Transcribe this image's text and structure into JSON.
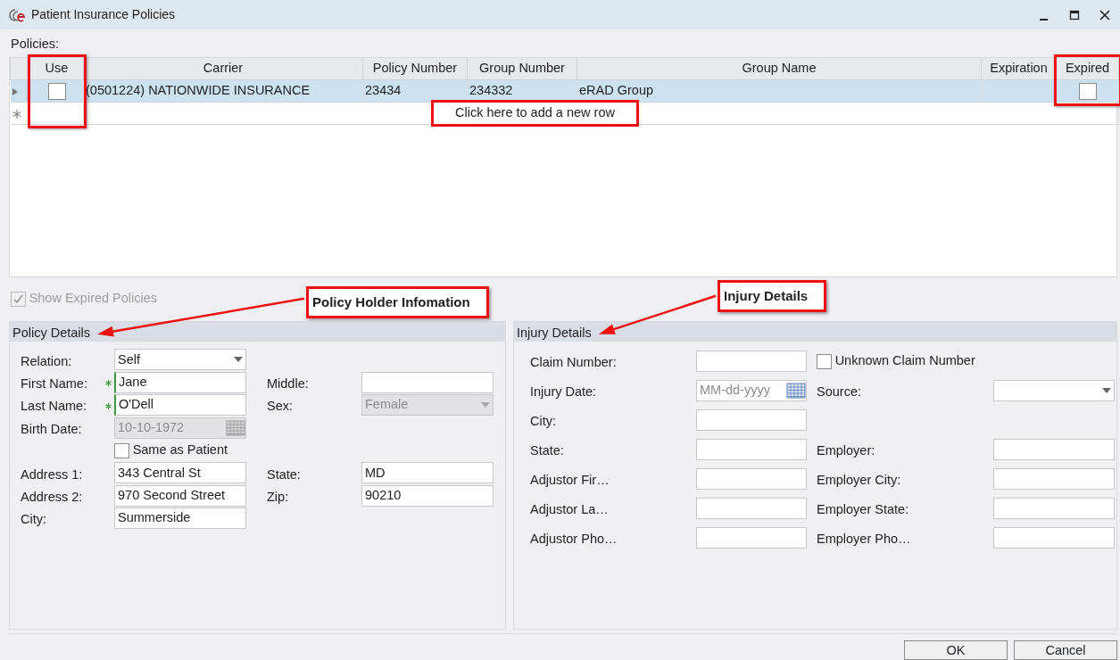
{
  "window": {
    "title": "Patient Insurance Policies"
  },
  "policies_label": "Policies:",
  "table": {
    "columns": [
      {
        "label": "Use",
        "kind": "checkbox",
        "highlighted": true
      },
      {
        "label": "Carrier",
        "kind": "text",
        "highlighted": false
      },
      {
        "label": "Policy Number",
        "kind": "text",
        "highlighted": false
      },
      {
        "label": "Group Number",
        "kind": "text",
        "highlighted": false
      },
      {
        "label": "Group Name",
        "kind": "text",
        "highlighted": false
      },
      {
        "label": "Expiration",
        "kind": "text",
        "highlighted": false
      },
      {
        "label": "Expired",
        "kind": "checkbox",
        "highlighted": true
      }
    ],
    "rows": [
      {
        "selected": true,
        "cells": [
          {
            "checked": false
          },
          {
            "text": "(0501224) NATIONWIDE INSURANCE"
          },
          {
            "text": "23434"
          },
          {
            "text": "234332"
          },
          {
            "text": "eRAD Group"
          },
          {},
          {
            "checked": false
          }
        ]
      }
    ],
    "new_row_hint": {
      "text": "Click here to add a new row",
      "highlighted": true
    }
  },
  "show_expired": {
    "label": "Show Expired Policies",
    "checked": true,
    "disabled": true
  },
  "panels": [
    {
      "title": "Policy Details",
      "callout": "Policy Holder Infomation",
      "rows": [
        {
          "left": {
            "kind": "select",
            "label": "Relation:",
            "value": "Self",
            "required": false,
            "disabled": false
          }
        },
        {
          "left": {
            "kind": "text",
            "label": "First Name:",
            "value": "Jane",
            "required": true,
            "disabled": false
          },
          "right": {
            "kind": "text",
            "label": "Middle:",
            "required": false,
            "disabled": false
          }
        },
        {
          "left": {
            "kind": "text",
            "label": "Last Name:",
            "value": "O'Dell",
            "required": true,
            "disabled": false
          },
          "right": {
            "kind": "select",
            "label": "Sex:",
            "value": "Female",
            "required": false,
            "disabled": true
          }
        },
        {
          "left": {
            "kind": "date",
            "label": "Birth Date:",
            "value": "10-10-1972",
            "required": false,
            "disabled": true
          }
        },
        {
          "left": {
            "kind": "checkbox",
            "label": "Same as Patient",
            "checked": false
          }
        },
        {
          "left": {
            "kind": "text",
            "label": "Address 1:",
            "value": "343 Central St",
            "required": false,
            "disabled": false
          },
          "right": {
            "kind": "text",
            "label": "State:",
            "value": "MD",
            "required": false,
            "disabled": false
          }
        },
        {
          "left": {
            "kind": "text",
            "label": "Address 2:",
            "value": "970 Second Street",
            "required": false,
            "disabled": false
          },
          "right": {
            "kind": "text",
            "label": "Zip:",
            "value": "90210",
            "required": false,
            "disabled": false
          }
        },
        {
          "left": {
            "kind": "text",
            "label": "City:",
            "value": "Summerside",
            "required": false,
            "disabled": false
          }
        }
      ]
    },
    {
      "title": "Injury Details",
      "callout": "Injury Details",
      "rows": [
        {
          "left": {
            "kind": "text",
            "label": "Claim Number:",
            "required": false,
            "disabled": false
          },
          "right": {
            "kind": "checkbox",
            "label": "Unknown Claim Number",
            "checked": false
          }
        },
        {
          "left": {
            "kind": "date",
            "label": "Injury Date:",
            "placeholder": "MM-dd-yyyy",
            "required": false,
            "disabled": false
          },
          "right": {
            "kind": "select",
            "label": "Source:",
            "required": false,
            "disabled": false
          }
        },
        {
          "left": {
            "kind": "text",
            "label": "City:",
            "required": false,
            "disabled": false
          }
        },
        {
          "left": {
            "kind": "text",
            "label": "State:",
            "required": false,
            "disabled": false
          },
          "right": {
            "kind": "text",
            "label": "Employer:",
            "required": false,
            "disabled": false
          }
        },
        {
          "left": {
            "kind": "text",
            "label": "Adjustor Fir…",
            "required": false,
            "disabled": false
          },
          "right": {
            "kind": "text",
            "label": "Employer City:",
            "required": false,
            "disabled": false
          }
        },
        {
          "left": {
            "kind": "text",
            "label": "Adjustor La…",
            "required": false,
            "disabled": false
          },
          "right": {
            "kind": "text",
            "label": "Employer State:",
            "required": false,
            "disabled": false
          }
        },
        {
          "left": {
            "kind": "text",
            "label": "Adjustor Pho…",
            "required": false,
            "disabled": false
          },
          "right": {
            "kind": "text",
            "label": "Employer Pho…",
            "required": false,
            "disabled": false
          }
        }
      ]
    }
  ],
  "buttons": [
    {
      "label": "OK"
    },
    {
      "label": "Cancel"
    }
  ]
}
